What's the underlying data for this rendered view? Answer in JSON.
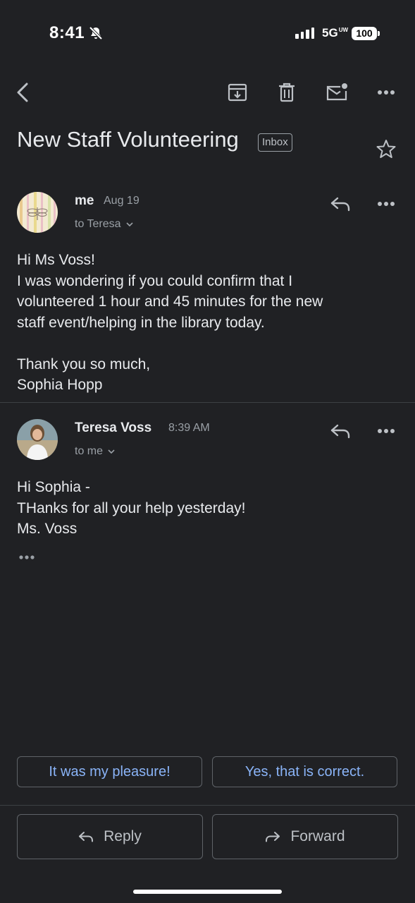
{
  "status_bar": {
    "time": "8:41",
    "network": "5G",
    "network_sup": "UW",
    "battery": "100"
  },
  "toolbar": {
    "icons": [
      "back-icon",
      "archive-icon",
      "trash-icon",
      "mark-unread-icon",
      "more-icon"
    ]
  },
  "thread": {
    "subject": "New Staff Volunteering",
    "label": "Inbox"
  },
  "messages": [
    {
      "sender": "me",
      "date": "Aug 19",
      "recipient": "to Teresa",
      "body": "Hi Ms Voss!\nI was wondering if you could confirm that I\nvolunteered 1 hour and 45 minutes for the new\nstaff event/helping in the library today.\n\nThank you so much,\nSophia Hopp"
    },
    {
      "sender": "Teresa Voss",
      "date": "8:39 AM",
      "recipient": "to me",
      "body": "Hi Sophia -\nTHanks for all your help yesterday!\nMs. Voss"
    }
  ],
  "smart_replies": [
    "It was my pleasure!",
    "Yes, that is correct."
  ],
  "actions": {
    "reply": "Reply",
    "forward": "Forward"
  },
  "colors": {
    "background": "#202124",
    "text": "#e8eaed",
    "secondary_text": "#9aa0a6",
    "accent": "#8ab4f8",
    "border": "#5f6368"
  }
}
